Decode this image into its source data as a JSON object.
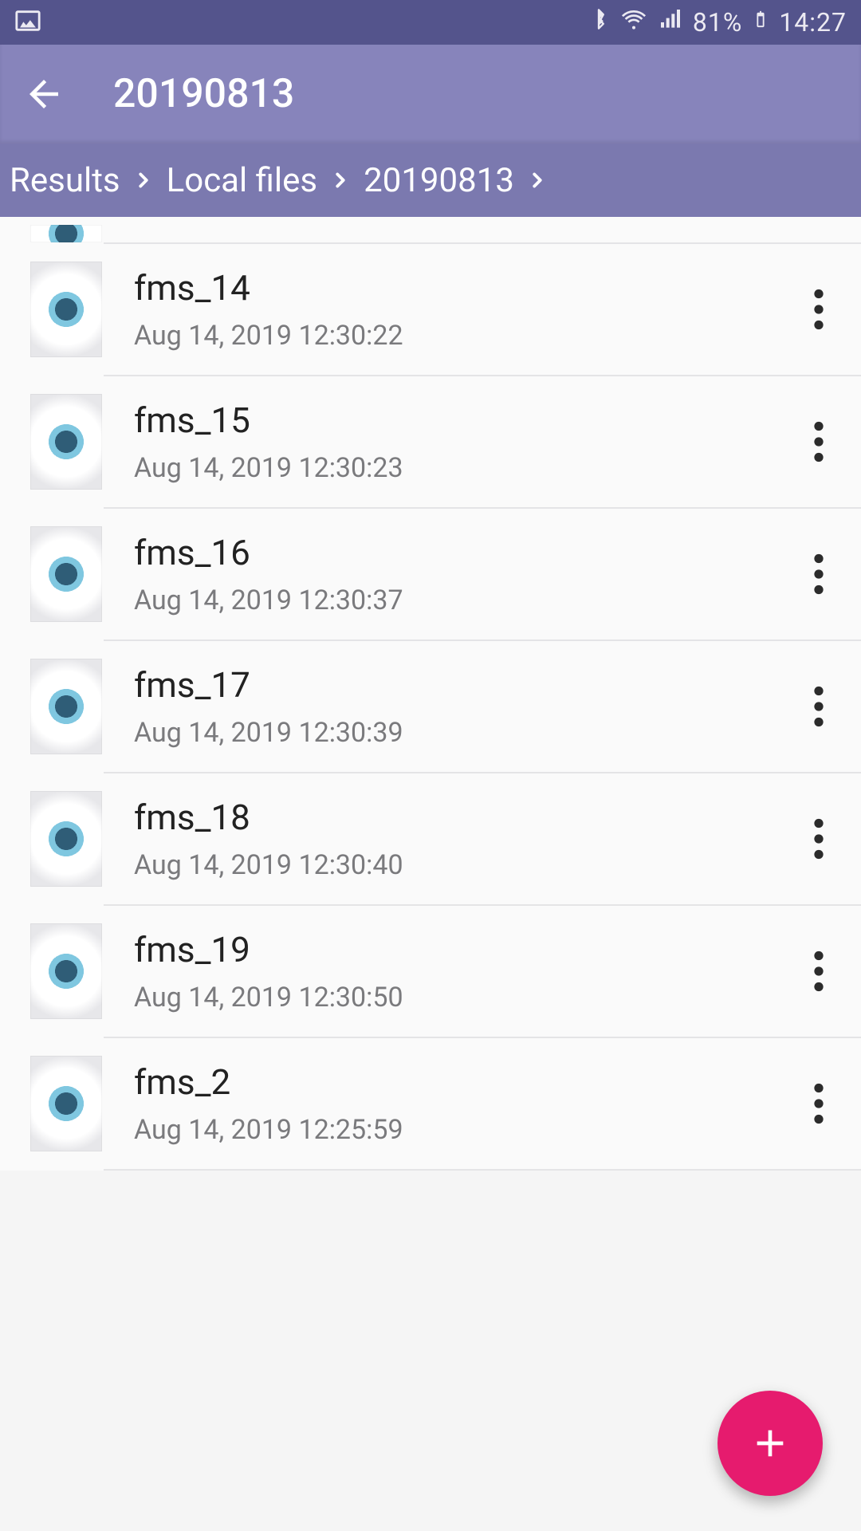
{
  "status": {
    "battery_pct": "81%",
    "time": "14:27"
  },
  "appbar": {
    "title": "20190813"
  },
  "breadcrumb": {
    "items": [
      "Results",
      "Local files",
      "20190813"
    ]
  },
  "files": [
    {
      "name": "fms_14",
      "date": "Aug 14, 2019 12:30:22"
    },
    {
      "name": "fms_15",
      "date": "Aug 14, 2019 12:30:23"
    },
    {
      "name": "fms_16",
      "date": "Aug 14, 2019 12:30:37"
    },
    {
      "name": "fms_17",
      "date": "Aug 14, 2019 12:30:39"
    },
    {
      "name": "fms_18",
      "date": "Aug 14, 2019 12:30:40"
    },
    {
      "name": "fms_19",
      "date": "Aug 14, 2019 12:30:50"
    },
    {
      "name": "fms_2",
      "date": "Aug 14, 2019 12:25:59"
    }
  ]
}
